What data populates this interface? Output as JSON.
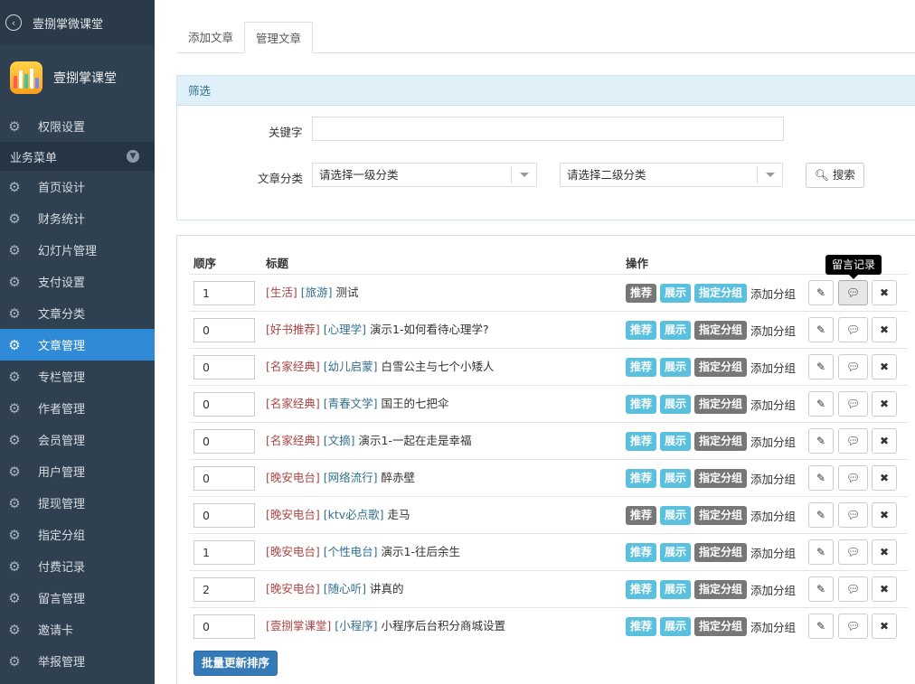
{
  "app": {
    "title": "壹捌掌微课堂",
    "brand_name": "壹捌掌课堂"
  },
  "sidebar": {
    "top_item": "权限设置",
    "section_label": "业务菜单",
    "items": [
      {
        "label": "首页设计",
        "active": false
      },
      {
        "label": "财务统计",
        "active": false
      },
      {
        "label": "幻灯片管理",
        "active": false
      },
      {
        "label": "支付设置",
        "active": false
      },
      {
        "label": "文章分类",
        "active": false
      },
      {
        "label": "文章管理",
        "active": true
      },
      {
        "label": "专栏管理",
        "active": false
      },
      {
        "label": "作者管理",
        "active": false
      },
      {
        "label": "会员管理",
        "active": false
      },
      {
        "label": "用户管理",
        "active": false
      },
      {
        "label": "提现管理",
        "active": false
      },
      {
        "label": "指定分组",
        "active": false
      },
      {
        "label": "付费记录",
        "active": false
      },
      {
        "label": "留言管理",
        "active": false
      },
      {
        "label": "邀请卡",
        "active": false
      },
      {
        "label": "举报管理",
        "active": false
      }
    ]
  },
  "tabs": [
    {
      "label": "添加文章",
      "active": false
    },
    {
      "label": "管理文章",
      "active": true
    }
  ],
  "filter": {
    "heading": "筛选",
    "keyword_label": "关键字",
    "keyword_value": "",
    "category_label": "文章分类",
    "category1": "请选择一级分类",
    "category2": "请选择二级分类",
    "search_label": "搜索"
  },
  "table": {
    "headers": {
      "order": "顺序",
      "title": "标题",
      "ops": "操作"
    },
    "labels": {
      "recommend": "推荐",
      "show": "展示",
      "assign_group": "指定分组",
      "add_group": "添加分组"
    },
    "tooltip": "留言记录",
    "rows": [
      {
        "order": "1",
        "cat1": "[生活]",
        "cat2": "[旅游]",
        "title": "测试",
        "recommend_on": false,
        "show_on": true,
        "group_on": true
      },
      {
        "order": "0",
        "cat1": "[好书推荐]",
        "cat2": "[心理学]",
        "title": "演示1-如何看待心理学?",
        "recommend_on": true,
        "show_on": true,
        "group_on": false
      },
      {
        "order": "0",
        "cat1": "[名家经典]",
        "cat2": "[幼儿启蒙]",
        "title": "白雪公主与七个小矮人",
        "recommend_on": true,
        "show_on": true,
        "group_on": false
      },
      {
        "order": "0",
        "cat1": "[名家经典]",
        "cat2": "[青春文学]",
        "title": "国王的七把伞",
        "recommend_on": true,
        "show_on": true,
        "group_on": false
      },
      {
        "order": "0",
        "cat1": "[名家经典]",
        "cat2": "[文摘]",
        "title": "演示1-一起在走是幸福",
        "recommend_on": true,
        "show_on": true,
        "group_on": false
      },
      {
        "order": "0",
        "cat1": "[晚安电台]",
        "cat2": "[网络流行]",
        "title": "醉赤壁",
        "recommend_on": true,
        "show_on": true,
        "group_on": false
      },
      {
        "order": "0",
        "cat1": "[晚安电台]",
        "cat2": "[ktv必点歌]",
        "title": "走马",
        "recommend_on": false,
        "show_on": true,
        "group_on": false
      },
      {
        "order": "1",
        "cat1": "[晚安电台]",
        "cat2": "[个性电台]",
        "title": "演示1-往后余生",
        "recommend_on": true,
        "show_on": true,
        "group_on": false
      },
      {
        "order": "2",
        "cat1": "[晚安电台]",
        "cat2": "[随心听]",
        "title": "讲真的",
        "recommend_on": true,
        "show_on": true,
        "group_on": false
      },
      {
        "order": "0",
        "cat1": "[壹捌掌课堂]",
        "cat2": "[小程序]",
        "title": "小程序后台积分商城设置",
        "recommend_on": true,
        "show_on": true,
        "group_on": false
      }
    ]
  },
  "batch_label": "批量更新排序",
  "colors": {
    "sidebar_bg": "#2f4050",
    "active_item": "#2f8ad8",
    "label_blue": "#5bc0de",
    "label_gray": "#777777",
    "primary": "#337ab7"
  }
}
